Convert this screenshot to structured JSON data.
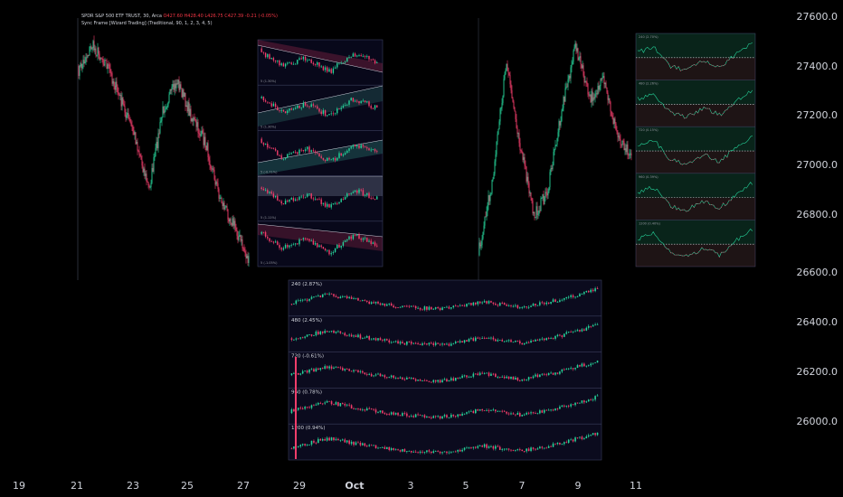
{
  "legend": {
    "line1_symbol": "SPDR S&P 500 ETF TRUST, 30, Arca",
    "line1_values": "O427.60 H428.40 L426.75 C427.39 -0.21 (-0.05%)",
    "line2": "Sync Frame [Wizard Trading] (Traditional, 90, 1, 2, 3, 4, 5)"
  },
  "price_axis": [
    "27600.0",
    "27400.0",
    "27200.0",
    "27000.0",
    "26800.0",
    "26600.0",
    "26400.0",
    "26200.0",
    "26000.0"
  ],
  "time_axis": [
    {
      "label": "19",
      "bold": false
    },
    {
      "label": "21",
      "bold": false
    },
    {
      "label": "23",
      "bold": false
    },
    {
      "label": "25",
      "bold": false
    },
    {
      "label": "27",
      "bold": false
    },
    {
      "label": "29",
      "bold": false
    },
    {
      "label": "Oct",
      "bold": true
    },
    {
      "label": "3",
      "bold": false
    },
    {
      "label": "5",
      "bold": false
    },
    {
      "label": "7",
      "bold": false
    },
    {
      "label": "9",
      "bold": false
    },
    {
      "label": "11",
      "bold": false
    }
  ],
  "panel_center": {
    "labels": [
      "5 (1.30%)",
      "5 (1.30%)",
      "5 (-0.71%)",
      "5 (1.11%)",
      "5 (-1.05%)"
    ]
  },
  "panel_bottom": {
    "labels": [
      "240 (2.87%)",
      "480 (2.45%)",
      "720 (-0.61%)",
      "960 (0.78%)",
      "1200 (0.94%)"
    ]
  },
  "panel_right": {
    "labels": [
      "240 (2.70%)",
      "480 (2.26%)",
      "720 (0.15%)",
      "960 (0.39%)",
      "1200 (0.40%)"
    ]
  },
  "colors": {
    "up": "#26d39a",
    "down": "#f23d6b",
    "panel_border": "#3a3f5c"
  }
}
